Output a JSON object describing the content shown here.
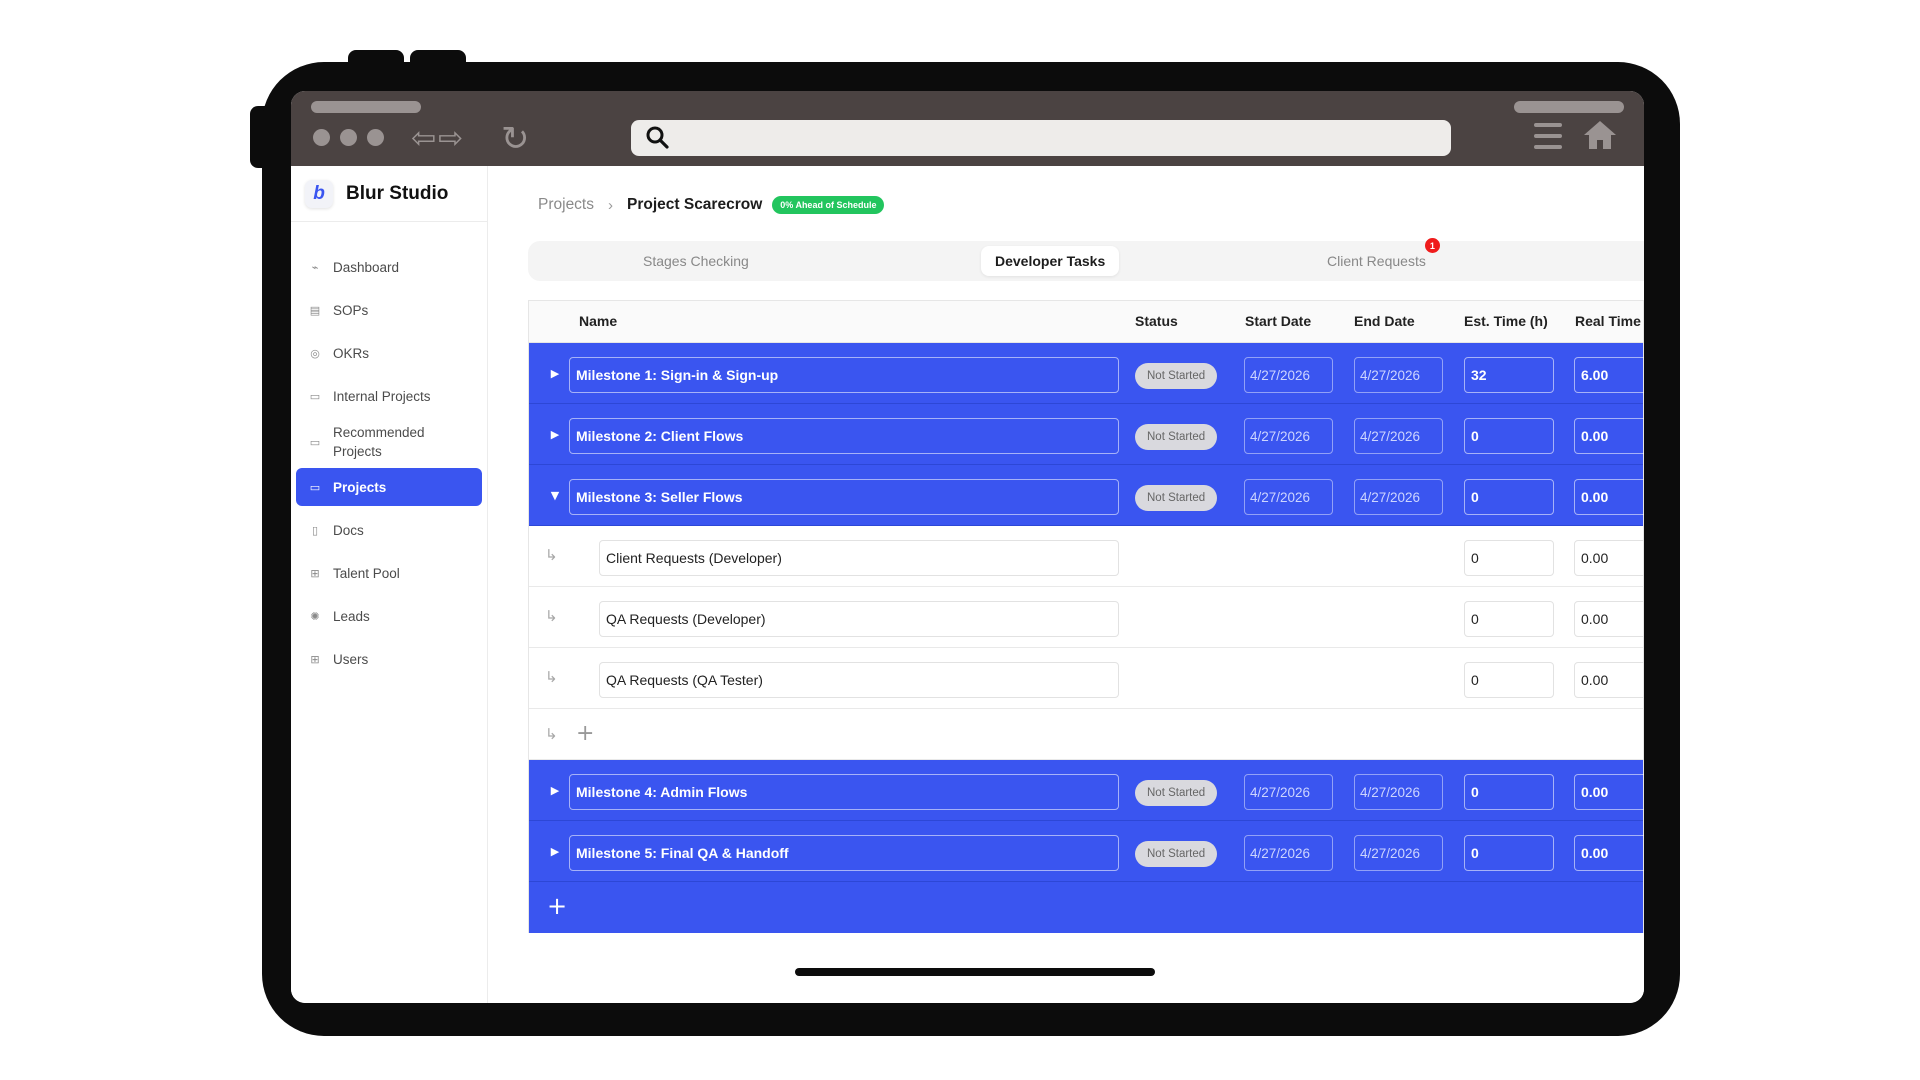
{
  "browser": {
    "search_icon": "search-icon",
    "back_forward_icons": "⇦⇨",
    "reload_icon": "↻"
  },
  "sidebar": {
    "brand_letter": "b",
    "brand_name": "Blur Studio",
    "items": [
      {
        "label": "Dashboard",
        "icon": "chart-icon",
        "glyph": "⌁"
      },
      {
        "label": "SOPs",
        "icon": "sop-icon",
        "glyph": "▤"
      },
      {
        "label": "OKRs",
        "icon": "target-icon",
        "glyph": "◎"
      },
      {
        "label": "Internal Projects",
        "icon": "folder-icon",
        "glyph": "▭"
      },
      {
        "label": "Recommended Projects",
        "icon": "folder-star-icon",
        "glyph": "▭"
      },
      {
        "label": "Projects",
        "icon": "folder-open-icon",
        "glyph": "▭"
      },
      {
        "label": "Docs",
        "icon": "doc-icon",
        "glyph": "▯"
      },
      {
        "label": "Talent Pool",
        "icon": "talent-icon",
        "glyph": "⊞"
      },
      {
        "label": "Leads",
        "icon": "leads-icon",
        "glyph": "✺"
      },
      {
        "label": "Users",
        "icon": "users-icon",
        "glyph": "⊞"
      }
    ],
    "active_item": "Projects"
  },
  "breadcrumb": {
    "parent": "Projects",
    "separator": "›",
    "current": "Project Scarecrow",
    "badge": "0% Ahead of Schedule"
  },
  "tabs": [
    {
      "label": "Stages Checking"
    },
    {
      "label": "Developer Tasks"
    },
    {
      "label": "Client Requests",
      "badge": "1"
    }
  ],
  "table": {
    "headers": {
      "name": "Name",
      "status": "Status",
      "start": "Start Date",
      "end": "End Date",
      "est": "Est. Time (h)",
      "real": "Real Time"
    },
    "milestones_top": [
      {
        "name": "Milestone 1: Sign-in & Sign-up",
        "status": "Not Started",
        "start": "4/27/2026",
        "end": "4/27/2026",
        "est": "32",
        "real": "6.00"
      },
      {
        "name": "Milestone 2: Client Flows",
        "status": "Not Started",
        "start": "4/27/2026",
        "end": "4/27/2026",
        "est": "0",
        "real": "0.00"
      },
      {
        "name": "Milestone 3: Seller Flows",
        "status": "Not Started",
        "start": "4/27/2026",
        "end": "4/27/2026",
        "est": "0",
        "real": "0.00"
      }
    ],
    "subtasks": [
      {
        "name": "Client Requests (Developer)",
        "est": "0",
        "real": "0.00"
      },
      {
        "name": "QA Requests (Developer)",
        "est": "0",
        "real": "0.00"
      },
      {
        "name": "QA Requests (QA Tester)",
        "est": "0",
        "real": "0.00"
      }
    ],
    "milestones_bottom": [
      {
        "name": "Milestone 4: Admin Flows",
        "status": "Not Started",
        "start": "4/27/2026",
        "end": "4/27/2026",
        "est": "0",
        "real": "0.00"
      },
      {
        "name": "Milestone 5: Final QA & Handoff",
        "status": "Not Started",
        "start": "4/27/2026",
        "end": "4/27/2026",
        "est": "0",
        "real": "0.00"
      }
    ],
    "collapsed_caret": "▶",
    "expanded_caret": "▼",
    "sub_arrow": "↳",
    "add_glyph": "+"
  },
  "colors": {
    "accent": "#3a55f0",
    "badge_green": "#22c55e",
    "notif_red": "#ef1c1c",
    "chrome": "#4b4342"
  }
}
